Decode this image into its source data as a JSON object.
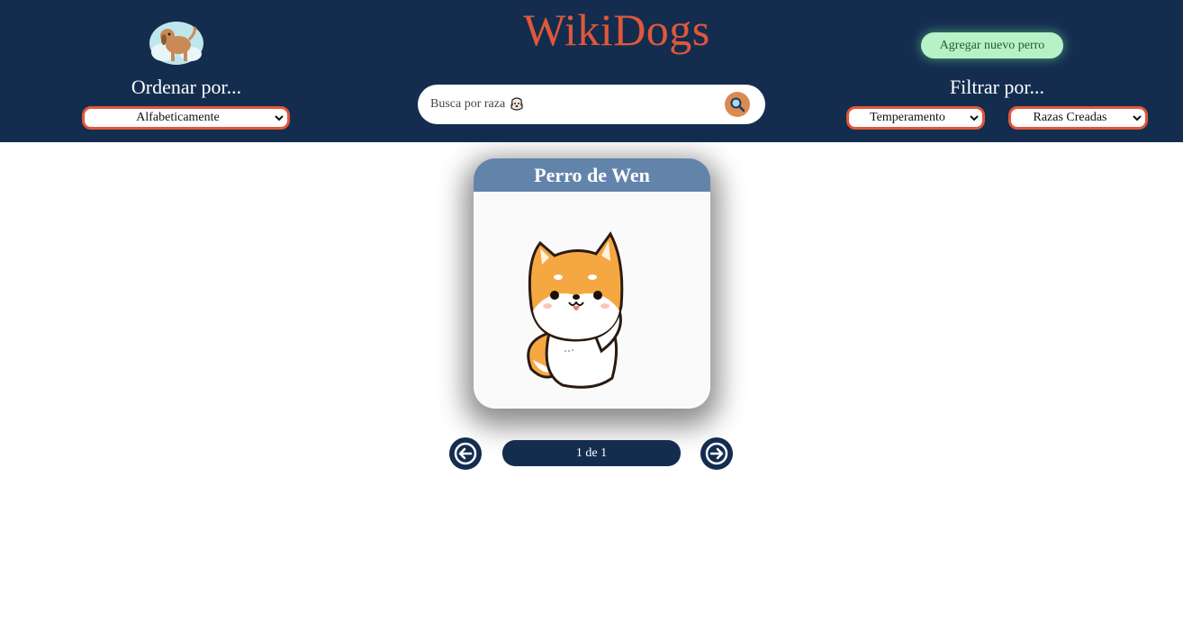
{
  "header": {
    "title": "WikiDogs",
    "sort": {
      "label": "Ordenar por...",
      "selected": "Alfabeticamente"
    },
    "search": {
      "placeholder": "Busca por raza"
    },
    "add_button": "Agregar nuevo perro",
    "filter": {
      "label": "Filtrar por...",
      "temperament_selected": "Temperamento",
      "breeds_selected": "Razas Creadas"
    }
  },
  "cards": [
    {
      "name": "Perro de Wen"
    }
  ],
  "pagination": {
    "label": "1 de 1"
  },
  "colors": {
    "header_bg": "#142d4f",
    "accent": "#e0583a",
    "card_header": "#6384aa",
    "add_button_bg": "#b7f2c6"
  },
  "icons": [
    "dog-logo-icon",
    "dog-face-icon",
    "search-icon",
    "chevron-down-icon",
    "arrow-left-icon",
    "arrow-right-icon",
    "shiba-dog-illustration"
  ]
}
